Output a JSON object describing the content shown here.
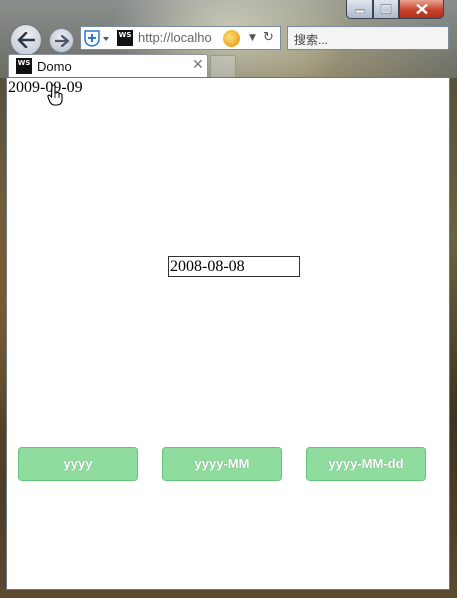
{
  "browser": {
    "url": "http://localho",
    "search_placeholder": "搜索...",
    "tab": {
      "title": "Domo",
      "favicon_text": "WS"
    }
  },
  "page": {
    "date_display": "2009-09-09",
    "date_input_value": "2008-08-08",
    "buttons": [
      {
        "label": "yyyy"
      },
      {
        "label": "yyyy-MM"
      },
      {
        "label": "yyyy-MM-dd"
      }
    ]
  },
  "colors": {
    "button_bg": "#8fdc9e",
    "button_border": "#63c47a",
    "button_text": "#ffffff"
  }
}
